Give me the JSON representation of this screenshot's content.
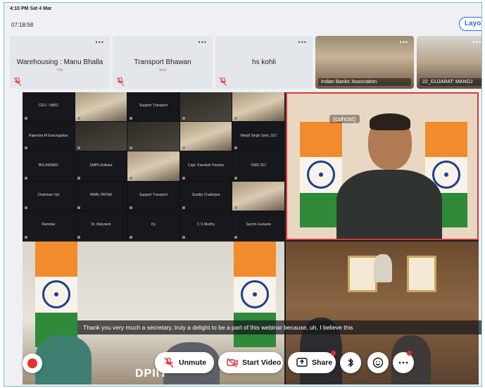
{
  "status": {
    "time_date": "4:10 PM  Sat 4 Mar",
    "timer": "07:18:58"
  },
  "layout_button": "Layo",
  "thumbnails": [
    {
      "name": "Warehousing : Manu Bhalla",
      "sub": "PM"
    },
    {
      "name": "Transport Bhawan",
      "sub": "Stott"
    },
    {
      "name": "hs kohli",
      "sub": ""
    },
    {
      "label": "Indian Banks' Association"
    },
    {
      "label": "22_GUJARAT: MANOJ"
    }
  ],
  "more_icon": "•••",
  "grid": [
    "CEO - NMIS",
    "",
    "Support Transport",
    "",
    "",
    "Rajendra M Kanungutkar",
    "",
    "",
    "",
    "Manjit Singh Saini, SCI",
    "BKLAMSMS",
    "SMPK,Kolkata",
    "",
    "Capt. Kamlesh Pandey",
    "OMD SCI",
    "Chairman Vpt",
    "NMAL PATNA",
    "Support Transport",
    "Sundip Chatterjee",
    "",
    "Ramdas",
    "Dr. Malyranit",
    "Dy",
    "C S Murthy",
    "Sachin Gunaste"
  ],
  "speaker_badge": "(cohost)",
  "caption": "Thank you very much a secretary, truly a delight to be a part of this webinar because, uh, I believe this",
  "toolbar": {
    "unmute": "Unmute",
    "start_video": "Start Video",
    "share": "Share"
  },
  "dpiit_label": "DPIIT",
  "accent_colors": {
    "record": "#e3342f",
    "active_speaker": "#d43b3b",
    "layout": "#2f6fd6"
  }
}
